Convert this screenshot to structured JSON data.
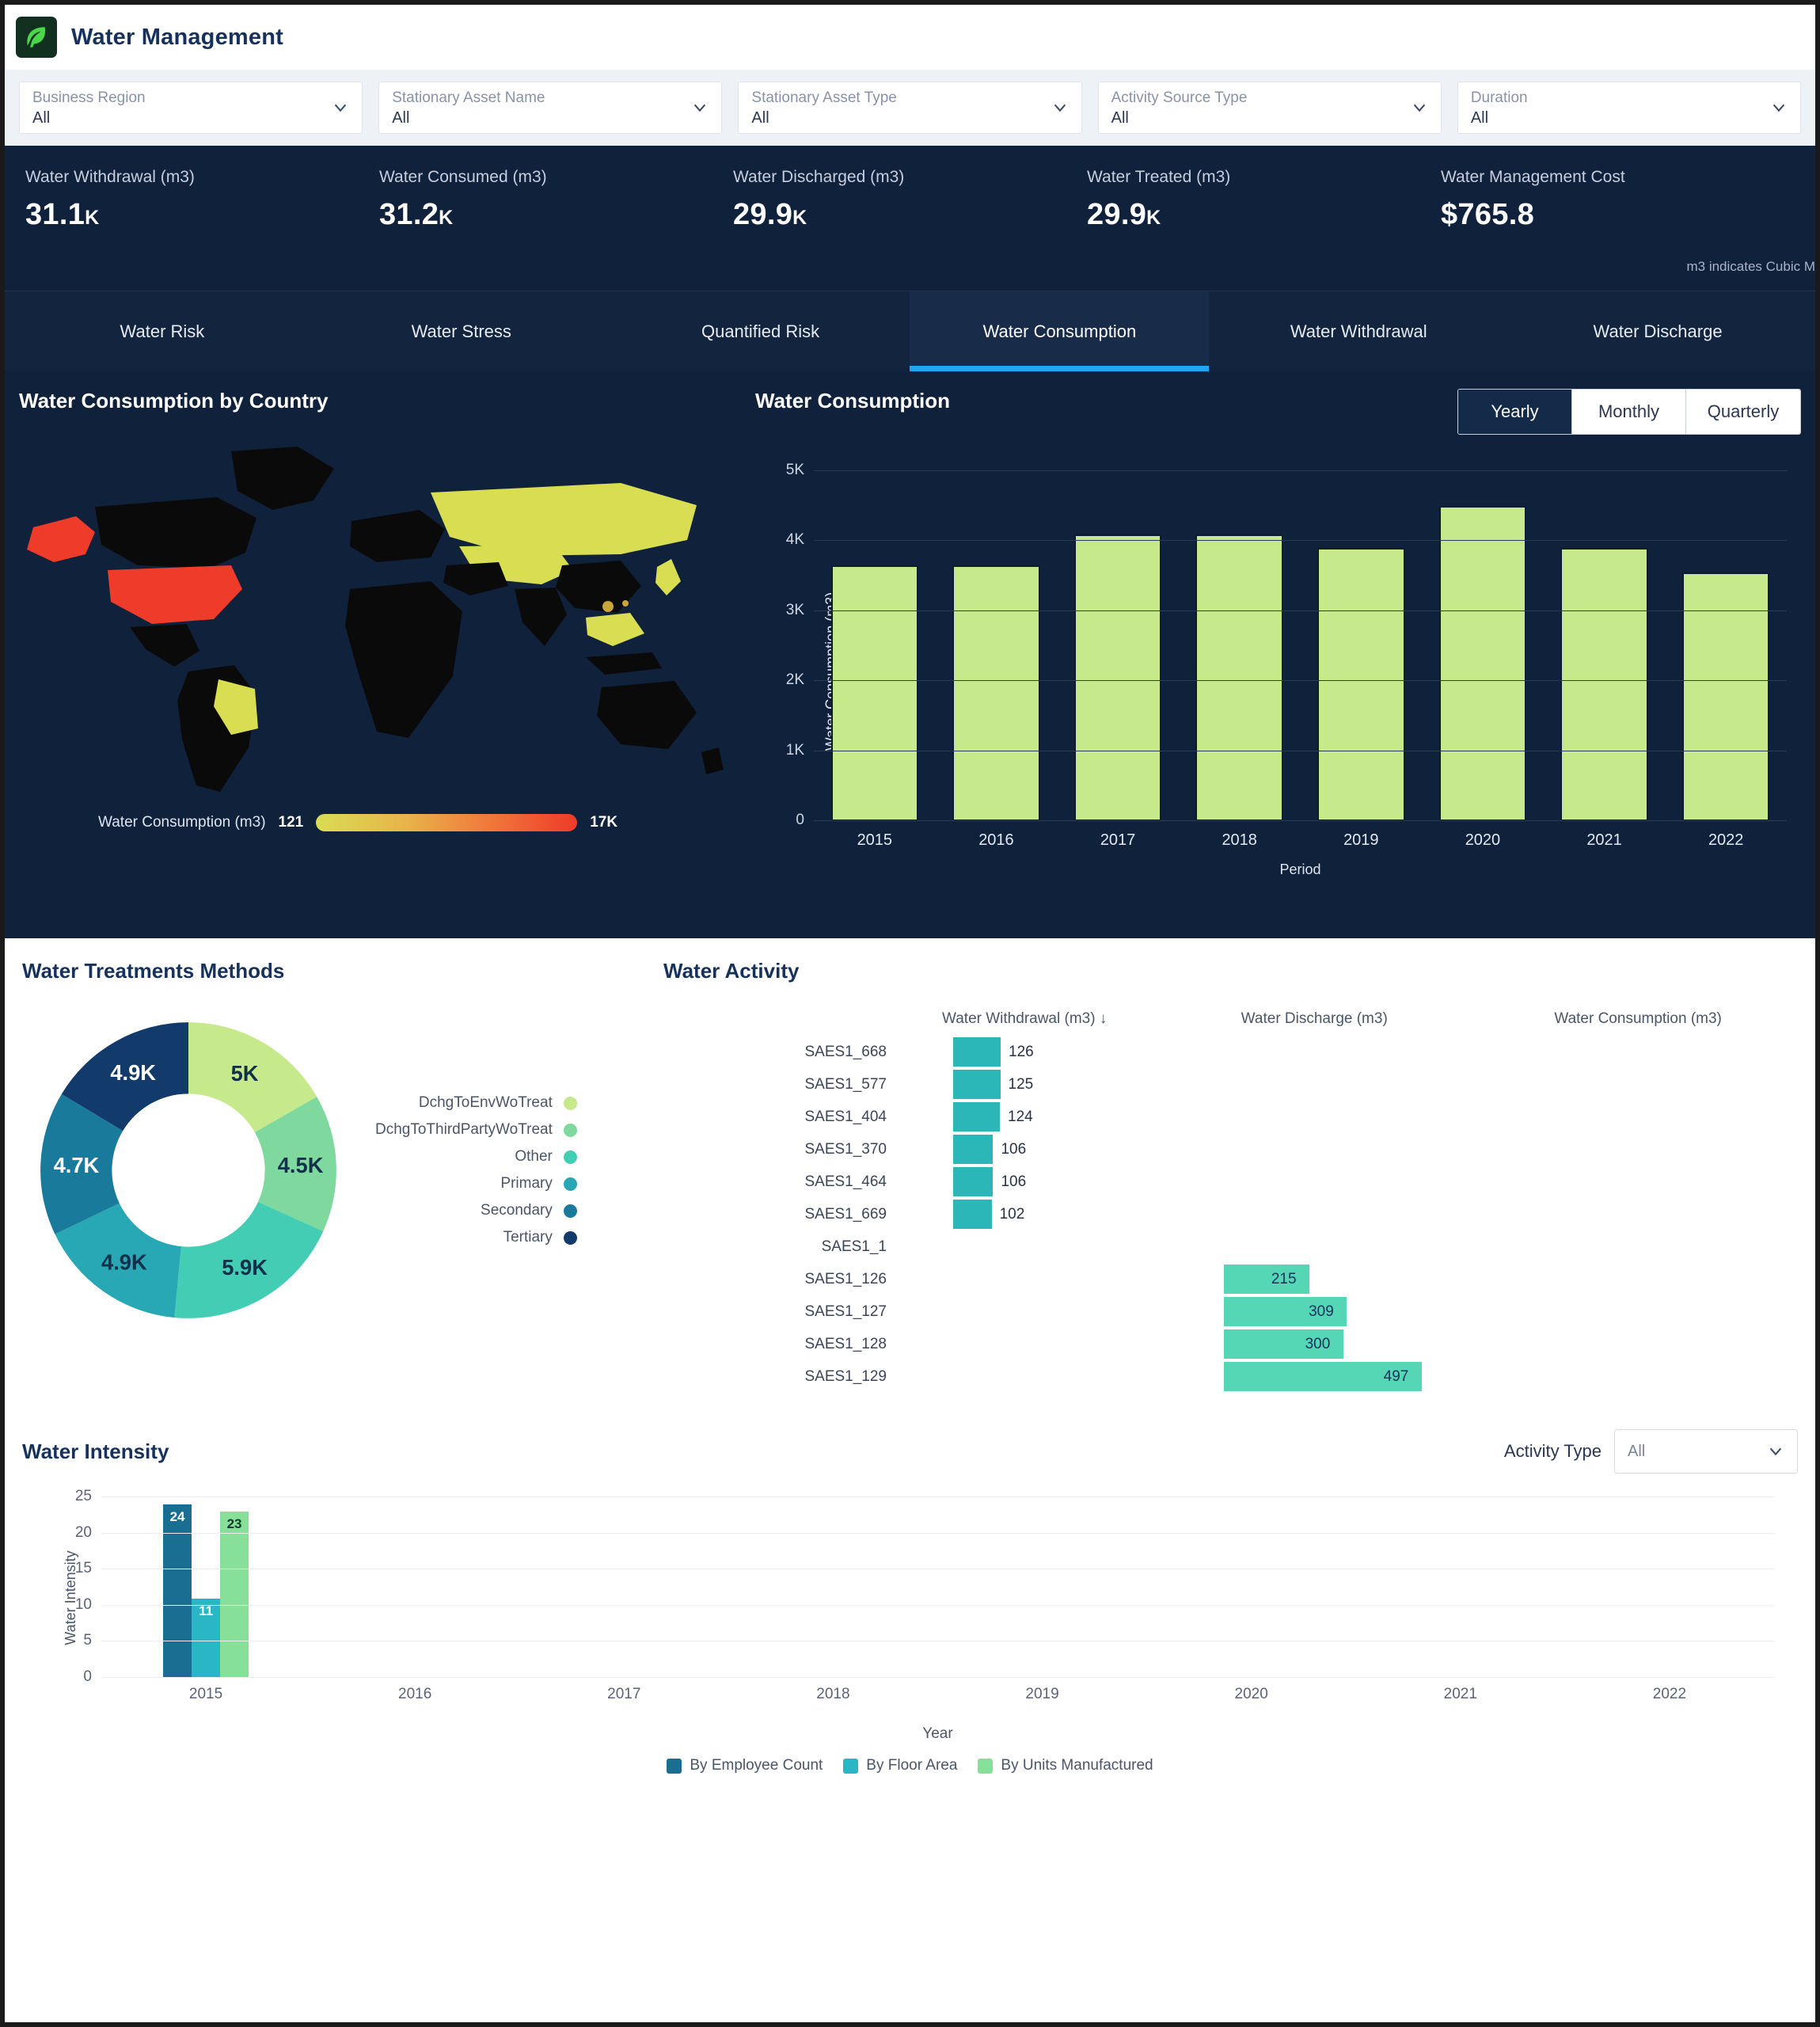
{
  "header": {
    "title": "Water Management",
    "logo_icon": "leaf-icon"
  },
  "filters": [
    {
      "label": "Business Region",
      "value": "All"
    },
    {
      "label": "Stationary Asset Name",
      "value": "All"
    },
    {
      "label": "Stationary Asset Type",
      "value": "All"
    },
    {
      "label": "Activity Source Type",
      "value": "All"
    },
    {
      "label": "Duration",
      "value": "All"
    }
  ],
  "kpis": [
    {
      "label": "Water Withdrawal (m3)",
      "value": "31.1",
      "suffix": "K"
    },
    {
      "label": "Water Consumed (m3)",
      "value": "31.2",
      "suffix": "K"
    },
    {
      "label": "Water Discharged (m3)",
      "value": "29.9",
      "suffix": "K"
    },
    {
      "label": "Water Treated (m3)",
      "value": "29.9",
      "suffix": "K"
    },
    {
      "label": "Water Management Cost",
      "value": "$765.8",
      "suffix": ""
    }
  ],
  "kpi_note": "m3 indicates Cubic M",
  "tabs": [
    {
      "label": "Water Risk",
      "active": false
    },
    {
      "label": "Water Stress",
      "active": false
    },
    {
      "label": "Quantified Risk",
      "active": false
    },
    {
      "label": "Water Consumption",
      "active": true
    },
    {
      "label": "Water Withdrawal",
      "active": false
    },
    {
      "label": "Water Discharge",
      "active": false
    }
  ],
  "map_panel": {
    "title": "Water Consumption by Country",
    "legend_label": "Water Consumption (m3)",
    "legend_min": "121",
    "legend_max": "17K"
  },
  "consumption_panel": {
    "title": "Water Consumption",
    "segments": [
      {
        "label": "Yearly",
        "active": true
      },
      {
        "label": "Monthly",
        "active": false
      },
      {
        "label": "Quarterly",
        "active": false
      }
    ]
  },
  "treatments": {
    "title": "Water Treatments Methods"
  },
  "activity": {
    "title": "Water Activity",
    "columns": [
      "Water Withdrawal (m3) ↓",
      "Water Discharge (m3)",
      "Water Consumption (m3)"
    ],
    "rows": [
      {
        "name": "SAES1_668",
        "withdrawal": "126",
        "discharge": "",
        "consumption": ""
      },
      {
        "name": "SAES1_577",
        "withdrawal": "125",
        "discharge": "",
        "consumption": ""
      },
      {
        "name": "SAES1_404",
        "withdrawal": "124",
        "discharge": "",
        "consumption": ""
      },
      {
        "name": "SAES1_370",
        "withdrawal": "106",
        "discharge": "",
        "consumption": ""
      },
      {
        "name": "SAES1_464",
        "withdrawal": "106",
        "discharge": "",
        "consumption": ""
      },
      {
        "name": "SAES1_669",
        "withdrawal": "102",
        "discharge": "",
        "consumption": ""
      },
      {
        "name": "SAES1_1",
        "withdrawal": "",
        "discharge": "",
        "consumption": ""
      },
      {
        "name": "SAES1_126",
        "withdrawal": "",
        "discharge": "215",
        "consumption": ""
      },
      {
        "name": "SAES1_127",
        "withdrawal": "",
        "discharge": "309",
        "consumption": ""
      },
      {
        "name": "SAES1_128",
        "withdrawal": "",
        "discharge": "300",
        "consumption": ""
      },
      {
        "name": "SAES1_129",
        "withdrawal": "",
        "discharge": "497",
        "consumption": ""
      }
    ]
  },
  "intensity": {
    "title": "Water Intensity",
    "activity_type_label": "Activity Type",
    "activity_type_value": "All"
  },
  "chart_data": [
    {
      "type": "bar",
      "id": "water-consumption-yearly",
      "title": "Water Consumption",
      "xlabel": "Period",
      "ylabel": "Water Consumption (m3)",
      "categories": [
        "2015",
        "2016",
        "2017",
        "2018",
        "2019",
        "2020",
        "2021",
        "2022"
      ],
      "values": [
        3650,
        3650,
        4100,
        4100,
        3900,
        4500,
        3900,
        3550
      ],
      "ylim": [
        0,
        5000
      ],
      "yticks": [
        0,
        1000,
        2000,
        3000,
        4000,
        5000
      ],
      "ytick_labels": [
        "0",
        "1K",
        "2K",
        "3K",
        "4K",
        "5K"
      ],
      "grid": true,
      "bar_color": "#c6e98b"
    },
    {
      "type": "pie",
      "id": "water-treatment-methods",
      "title": "Water Treatments Methods",
      "labels": [
        "DchgToEnvWoTreat",
        "DchgToThirdPartyWoTreat",
        "Other",
        "Primary",
        "Secondary",
        "Tertiary"
      ],
      "value_labels": [
        "5K",
        "4.5K",
        "5.9K",
        "4.9K",
        "4.7K",
        "4.9K"
      ],
      "values": [
        5000,
        4500,
        5900,
        4900,
        4700,
        4900
      ],
      "colors": [
        "#c6e98b",
        "#7fd99f",
        "#43cdb4",
        "#28a7b5",
        "#1a7a9b",
        "#123a6b"
      ],
      "legend": "right"
    },
    {
      "type": "bar",
      "id": "water-activity-withdrawal",
      "title": "Water Withdrawal (m3)",
      "categories": [
        "SAES1_668",
        "SAES1_577",
        "SAES1_404",
        "SAES1_370",
        "SAES1_464",
        "SAES1_669"
      ],
      "values": [
        126,
        125,
        124,
        106,
        106,
        102
      ],
      "orientation": "horizontal",
      "bar_color": "#2bb7b8"
    },
    {
      "type": "bar",
      "id": "water-activity-discharge",
      "title": "Water Discharge (m3)",
      "categories": [
        "SAES1_126",
        "SAES1_127",
        "SAES1_128",
        "SAES1_129"
      ],
      "values": [
        215,
        309,
        300,
        497
      ],
      "orientation": "horizontal",
      "bar_color": "#55d6b4"
    },
    {
      "type": "bar",
      "id": "water-intensity",
      "title": "Water Intensity",
      "xlabel": "Year",
      "ylabel": "Water Intensity",
      "categories": [
        "2015",
        "2016",
        "2017",
        "2018",
        "2019",
        "2020",
        "2021",
        "2022"
      ],
      "series": [
        {
          "name": "By Employee Count",
          "values": [
            24,
            null,
            null,
            null,
            null,
            null,
            null,
            null
          ],
          "color": "#1a6e91"
        },
        {
          "name": "By Floor Area",
          "values": [
            11,
            null,
            null,
            null,
            null,
            null,
            null,
            null
          ],
          "color": "#2ab6c4"
        },
        {
          "name": "By Units Manufactured",
          "values": [
            23,
            null,
            null,
            null,
            null,
            null,
            null,
            null
          ],
          "color": "#86e09a"
        }
      ],
      "ylim": [
        0,
        25
      ],
      "yticks": [
        0,
        5,
        10,
        15,
        20,
        25
      ],
      "grid": true,
      "legend": "bottom"
    }
  ]
}
